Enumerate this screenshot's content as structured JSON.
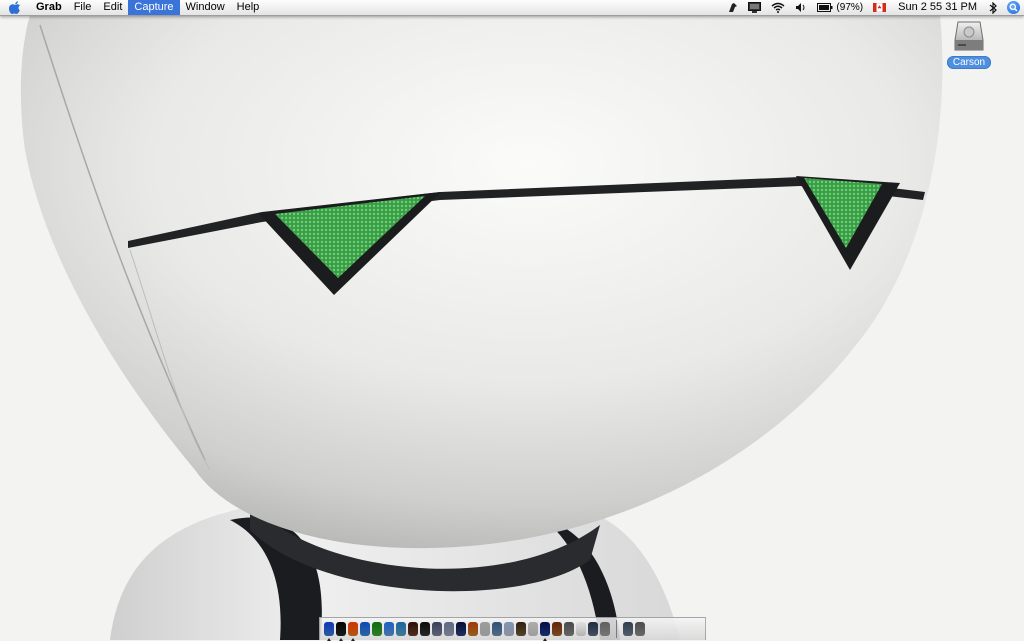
{
  "menubar": {
    "app_name": "Grab",
    "menus": [
      "File",
      "Edit",
      "Capture",
      "Window",
      "Help"
    ],
    "active_menu": "Capture",
    "battery_text": "(97%)",
    "clock": "Sun 2 55 31 PM"
  },
  "desktop": {
    "hd_label": "Carson"
  },
  "colors": {
    "menu_highlight": "#3a74d9",
    "eye_green": "#3ea84a",
    "label_blue": "#4f8fe0"
  },
  "dock": {
    "apps": [
      {
        "icon": "finder-icon",
        "color": "#3b78d8",
        "running": true
      },
      {
        "icon": "dashboard-icon",
        "color": "#222222",
        "running": true
      },
      {
        "icon": "firefox-icon",
        "color": "#e8731d",
        "running": true
      },
      {
        "icon": "safari-icon",
        "color": "#3a88d8",
        "running": false
      },
      {
        "icon": "camino-icon",
        "color": "#3fa63b",
        "running": false
      },
      {
        "icon": "itunes-icon",
        "color": "#5c9be0",
        "running": false
      },
      {
        "icon": "globe-icon",
        "color": "#58a0c8",
        "running": false
      },
      {
        "icon": "character-icon",
        "color": "#6a3e2a",
        "running": false
      },
      {
        "icon": "camera-icon",
        "color": "#333333",
        "running": false
      },
      {
        "icon": "preview-icon",
        "color": "#7b7f99",
        "running": false
      },
      {
        "icon": "ichat-icon",
        "color": "#9aa4b8",
        "running": false
      },
      {
        "icon": "terminal-icon",
        "color": "#2a3f7a",
        "running": false
      },
      {
        "icon": "guitar-icon",
        "color": "#c87a2d",
        "running": false
      },
      {
        "icon": "textedit-icon",
        "color": "#c8c8c8",
        "running": false
      },
      {
        "icon": "mail-icon",
        "color": "#6f8fb0",
        "running": false
      },
      {
        "icon": "calendar-icon",
        "color": "#b6c2d6",
        "running": false
      },
      {
        "icon": "photo-icon",
        "color": "#6e5a3e",
        "running": false
      },
      {
        "icon": "book-icon",
        "color": "#d2d2d2",
        "running": false
      },
      {
        "icon": "plane-icon",
        "color": "#1e3d8a",
        "running": true
      },
      {
        "icon": "tools-icon",
        "color": "#a06030",
        "running": false
      },
      {
        "icon": "system-preferences-icon",
        "color": "#888888",
        "running": false
      },
      {
        "icon": "document-icon",
        "color": "#efefef",
        "running": false
      },
      {
        "icon": "network-icon",
        "color": "#5a6a80",
        "running": false
      },
      {
        "icon": "utility-icon",
        "color": "#9c9c9c",
        "running": false
      }
    ],
    "right_items": [
      {
        "icon": "folder-stack-icon",
        "color": "#6f7d8e"
      },
      {
        "icon": "trash-icon",
        "color": "#8c8c8c"
      }
    ]
  }
}
